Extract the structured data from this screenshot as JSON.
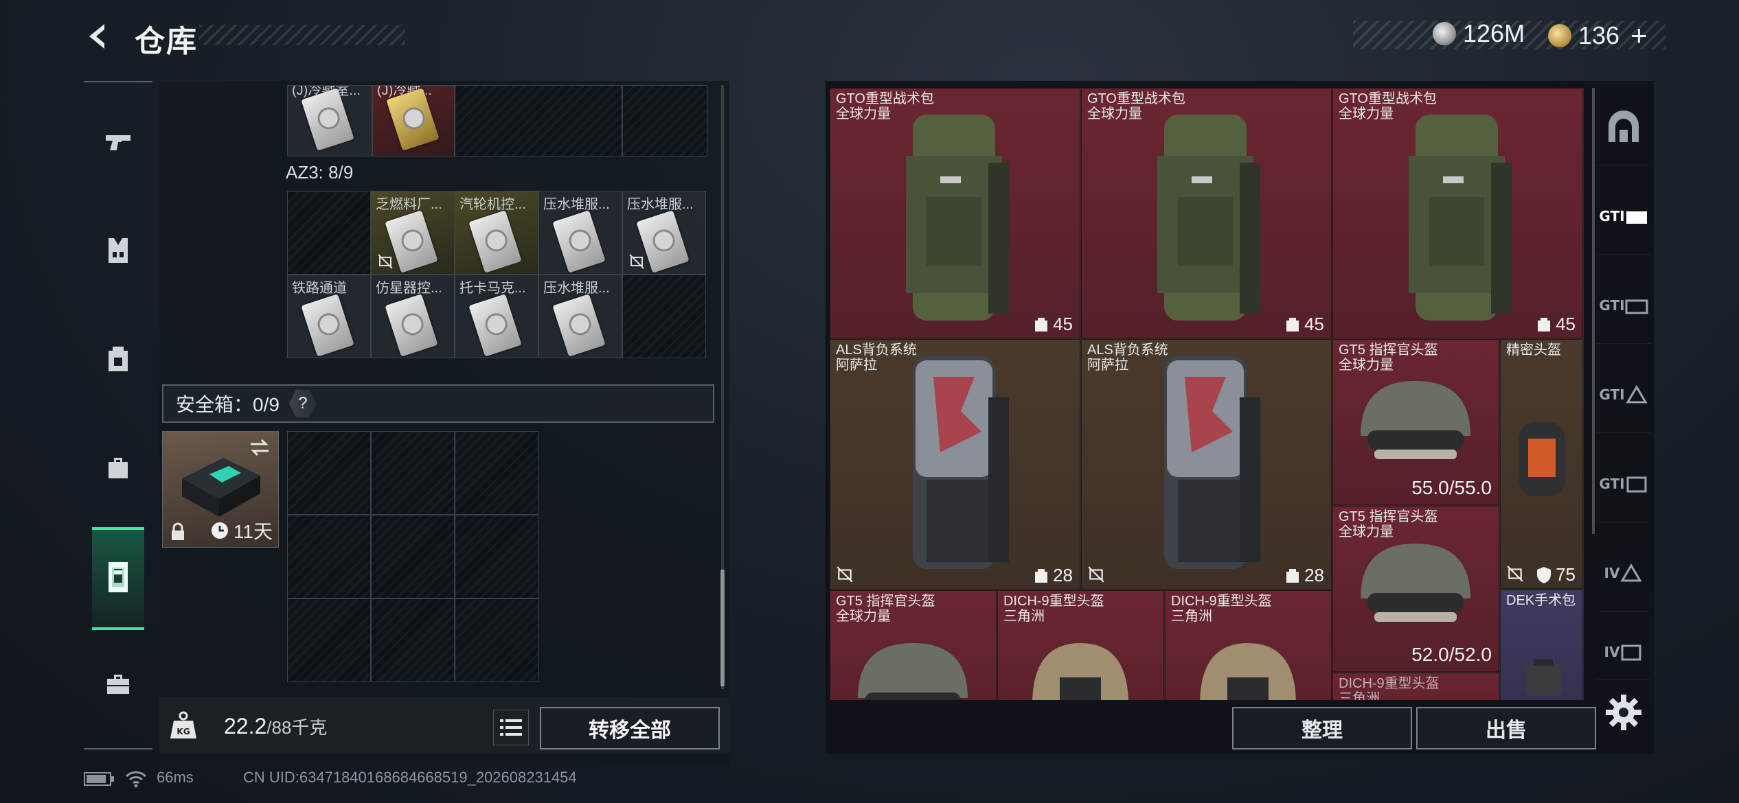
{
  "header": {
    "title": "仓库",
    "currency_silver": "126M",
    "currency_gold": "136",
    "currency_plus": "+"
  },
  "left": {
    "top_items": [
      {
        "name": "(J)冷藏室..."
      },
      {
        "name": "(J)冷藏..."
      }
    ],
    "az3_label": "AZ3: 8/9",
    "az3_items": [
      {
        "name": "乏燃料厂..."
      },
      {
        "name": "汽轮机控..."
      },
      {
        "name": "压水堆服..."
      },
      {
        "name": "压水堆服..."
      },
      {
        "name": "铁路通道"
      },
      {
        "name": "仿星器控..."
      },
      {
        "name": "托卡马克..."
      },
      {
        "name": "压水堆服..."
      }
    ],
    "safe_box_label": "安全箱：0/9",
    "help": "?",
    "safe_item_time": "11天",
    "weight_value": "22.2",
    "weight_max": "/88千克",
    "transfer_all": "转移全部"
  },
  "stash": {
    "items": [
      {
        "line1": "GTO重型战术包",
        "line2": "全球力量",
        "capacity": "45"
      },
      {
        "line1": "GTO重型战术包",
        "line2": "全球力量",
        "capacity": "45"
      },
      {
        "line1": "GTO重型战术包",
        "line2": "全球力量",
        "capacity": "45"
      },
      {
        "line1": "ALS背负系统",
        "line2": "阿萨拉",
        "capacity": "28"
      },
      {
        "line1": "ALS背负系统",
        "line2": "阿萨拉",
        "capacity": "28"
      },
      {
        "line1": "GT5 指挥官头盔",
        "line2": "全球力量",
        "durability": "55.0/55.0"
      },
      {
        "line1": "精密头盔",
        "line2": "",
        "armor": "75"
      },
      {
        "line1": "GT5 指挥官头盔",
        "line2": "全球力量",
        "durability": "52.0/52.0"
      },
      {
        "line1": "GT5 指挥官头盔",
        "line2": "全球力量"
      },
      {
        "line1": "DICH-9重型头盔",
        "line2": "三角洲"
      },
      {
        "line1": "DICH-9重型头盔",
        "line2": "三角洲"
      },
      {
        "line1": "DEK手术包",
        "line2": ""
      },
      {
        "line1": "DICH-9重型头盔",
        "line2": "三角洲"
      }
    ],
    "sort": "整理",
    "sell": "出售"
  },
  "right_rail": {
    "labels": [
      "GTI",
      "GTI",
      "GTI",
      "GTI",
      "IV",
      "IV"
    ]
  },
  "status": {
    "ping": "66ms",
    "uid": "CN UID:634718401686846685​19_202608231454"
  },
  "colors": {
    "accent_green": "#3fe6a0",
    "rarity_red": "#6a2630",
    "rarity_brown": "#4a3a2c",
    "rarity_blue": "#3e3c60"
  }
}
